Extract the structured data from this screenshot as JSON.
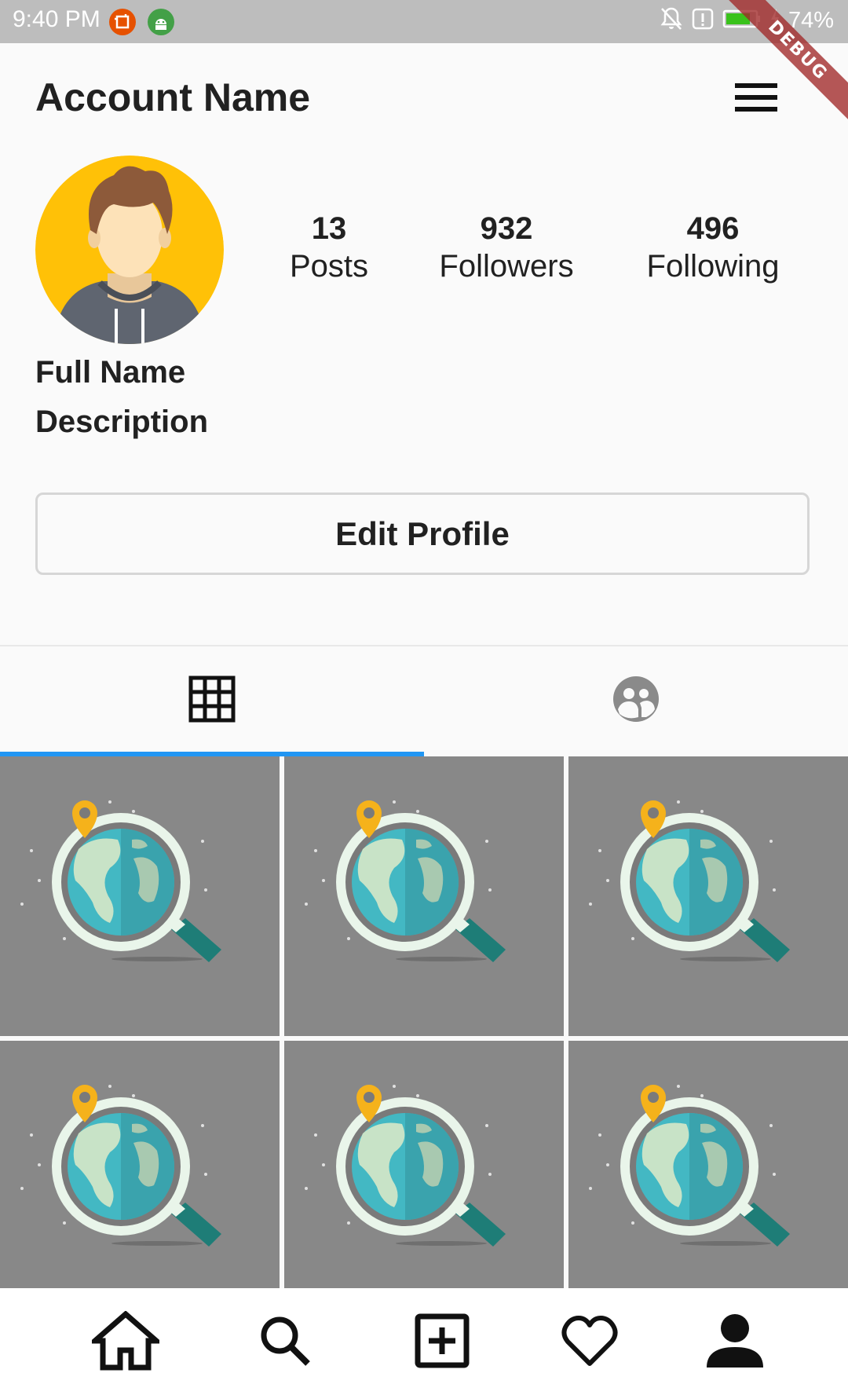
{
  "status_bar": {
    "time": "9:40 PM",
    "battery_percent": "74%",
    "icons": [
      "screenshot-app-icon",
      "android-app-icon",
      "bell-off-icon",
      "alert-icon",
      "battery-icon",
      "charging-bolt-icon"
    ]
  },
  "debug_banner": "DEBUG",
  "header": {
    "title": "Account Name",
    "menu_icon": "hamburger-menu-icon"
  },
  "profile": {
    "avatar_icon": "user-avatar-illustration",
    "stats": [
      {
        "count": "13",
        "label": "Posts"
      },
      {
        "count": "932",
        "label": "Followers"
      },
      {
        "count": "496",
        "label": "Following"
      }
    ],
    "full_name": "Full Name",
    "description": "Description",
    "edit_button_label": "Edit Profile"
  },
  "tabs": [
    {
      "icon": "grid-icon",
      "selected": true
    },
    {
      "icon": "tagged-people-icon",
      "selected": false
    }
  ],
  "grid": {
    "thumbnail_icon": "globe-magnifier-illustration",
    "count_visible": 6
  },
  "bottom_nav": [
    {
      "icon": "home-icon"
    },
    {
      "icon": "search-icon"
    },
    {
      "icon": "add-post-icon"
    },
    {
      "icon": "heart-icon"
    },
    {
      "icon": "profile-icon"
    }
  ],
  "colors": {
    "status_bar": "#bdbdbd",
    "background": "#fafafa",
    "tab_indicator": "#2196f3",
    "thumbnail_bg": "#888888",
    "avatar_bg": "#ffc107"
  }
}
